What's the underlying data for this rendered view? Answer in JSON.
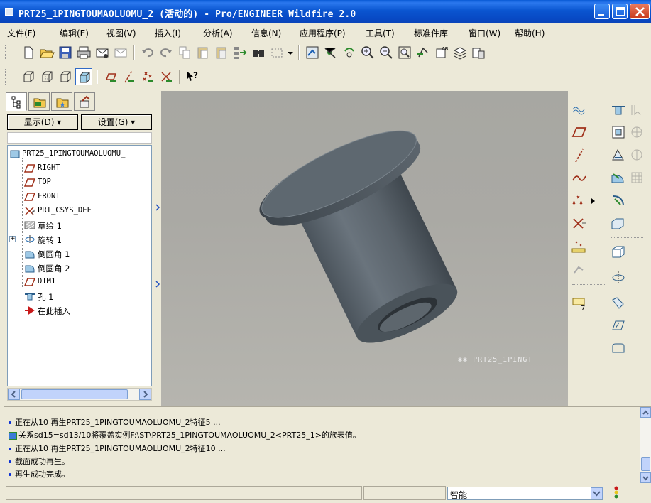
{
  "window": {
    "title": "PRT25_1PINGTOUMAOLUOMU_2 (活动的) - Pro/ENGINEER Wildfire 2.0"
  },
  "menu": [
    "文件(F)",
    "编辑(E)",
    "视图(V)",
    "插入(I)",
    "分析(A)",
    "信息(N)",
    "应用程序(P)",
    "工具(T)",
    "标准件库",
    "窗口(W)",
    "帮助(H)"
  ],
  "panel": {
    "show_button": "显示(D) ▾",
    "settings_button": "设置(G) ▾"
  },
  "tree": {
    "root": "PRT25_1PINGTOUMAOLUOMU_",
    "items": [
      {
        "label": "RIGHT",
        "icon": "datum-plane-icon"
      },
      {
        "label": "TOP",
        "icon": "datum-plane-icon"
      },
      {
        "label": "FRONT",
        "icon": "datum-plane-icon"
      },
      {
        "label": "PRT_CSYS_DEF",
        "icon": "csys-icon"
      },
      {
        "label": "草绘 1",
        "icon": "sketch-icon"
      },
      {
        "label": "旋转 1",
        "icon": "revolve-icon"
      },
      {
        "label": "倒圆角 1",
        "icon": "round-icon"
      },
      {
        "label": "倒圆角 2",
        "icon": "round-icon"
      },
      {
        "label": "DTM1",
        "icon": "datum-plane-icon"
      },
      {
        "label": "孔 1",
        "icon": "hole-icon"
      },
      {
        "label": "在此插入",
        "icon": "insert-arrow-icon"
      }
    ]
  },
  "graphics": {
    "model_label": "PRT25_1PINGT"
  },
  "messages": [
    "正在从10 再生PRT25_1PINGTOUMAOLUOMU_2特征5 ...",
    "关系sd15=sd13/10将覆盖实例F:\\ST\\PRT25_1PINGTOUMAOLUOMU_2<PRT25_1>的族表值。",
    "正在从10 再生PRT25_1PINGTOUMAOLUOMU_2特征10 ...",
    "截面成功再生。",
    "再生成功完成。"
  ],
  "status": {
    "filter_value": "智能"
  },
  "colors": {
    "title_bar": "#0a55d0",
    "background": "#ece9d8",
    "viewport": "#a9a8a3",
    "model": "#5f6870"
  }
}
